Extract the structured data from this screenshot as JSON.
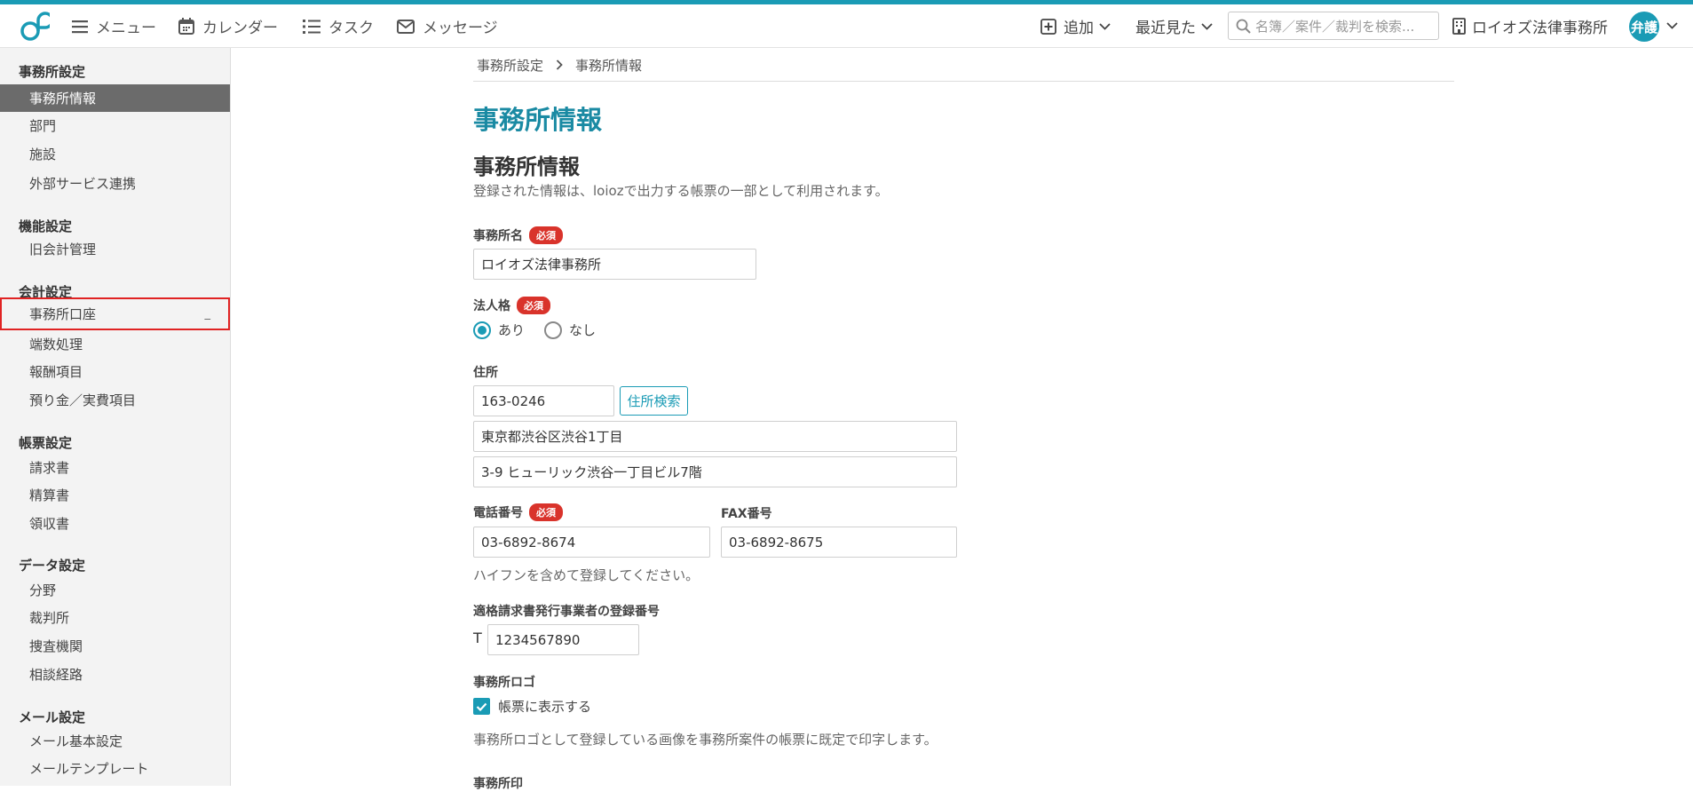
{
  "header": {
    "nav": [
      {
        "label": "メニュー",
        "icon": "hamburger-icon"
      },
      {
        "label": "カレンダー",
        "icon": "calendar-icon"
      },
      {
        "label": "タスク",
        "icon": "list-icon"
      },
      {
        "label": "メッセージ",
        "icon": "mail-icon"
      }
    ],
    "add_label": "追加",
    "recent_label": "最近見た",
    "search_placeholder": "名簿／案件／裁判を検索...",
    "office_name": "ロイオズ法律事務所",
    "avatar_text": "弁護",
    "accent_color": "#1a9bb5"
  },
  "sidebar": {
    "sections": [
      {
        "title": "事務所設定",
        "items": [
          "事務所情報",
          "部門",
          "施設",
          "外部サービス連携"
        ]
      },
      {
        "title": "機能設定",
        "items": [
          "旧会計管理"
        ]
      },
      {
        "title": "会計設定",
        "items": [
          "事務所口座",
          "端数処理",
          "報酬項目",
          "預り金／実費項目"
        ]
      },
      {
        "title": "帳票設定",
        "items": [
          "請求書",
          "精算書",
          "領収書"
        ]
      },
      {
        "title": "データ設定",
        "items": [
          "分野",
          "裁判所",
          "捜査機関",
          "相談経路"
        ]
      },
      {
        "title": "メール設定",
        "items": [
          "メール基本設定",
          "メールテンプレート"
        ]
      }
    ],
    "active_item": "事務所情報",
    "highlighted_item": "事務所口座",
    "highlight_marker": "_"
  },
  "breadcrumb": [
    "事務所設定",
    "事務所情報"
  ],
  "page_title": "事務所情報",
  "section_title": "事務所情報",
  "section_desc": "登録された情報は、loiozで出力する帳票の一部として利用されます。",
  "form": {
    "required_badge": "必須",
    "office_name_label": "事務所名",
    "office_name_value": "ロイオズ法律事務所",
    "corp_label": "法人格",
    "corp_yes": "あり",
    "corp_no": "なし",
    "corp_selected": "あり",
    "address_label": "住所",
    "postal_value": "163-0246",
    "address_search_button": "住所検索",
    "address1_value": "東京都渋谷区渋谷1丁目",
    "address2_value": "3-9 ヒューリック渋谷一丁目ビル7階",
    "phone_label": "電話番号",
    "phone_value": "03-6892-8674",
    "fax_label": "FAX番号",
    "fax_value": "03-6892-8675",
    "phone_hint": "ハイフンを含めて登録してください。",
    "invoice_reg_label": "適格請求書発行事業者の登録番号",
    "invoice_prefix": "T",
    "invoice_value": "1234567890",
    "logo_label": "事務所ロゴ",
    "logo_check_label": "帳票に表示する",
    "logo_checked": true,
    "logo_hint": "事務所ロゴとして登録している画像を事務所案件の帳票に既定で印字します。",
    "seal_label": "事務所印"
  }
}
